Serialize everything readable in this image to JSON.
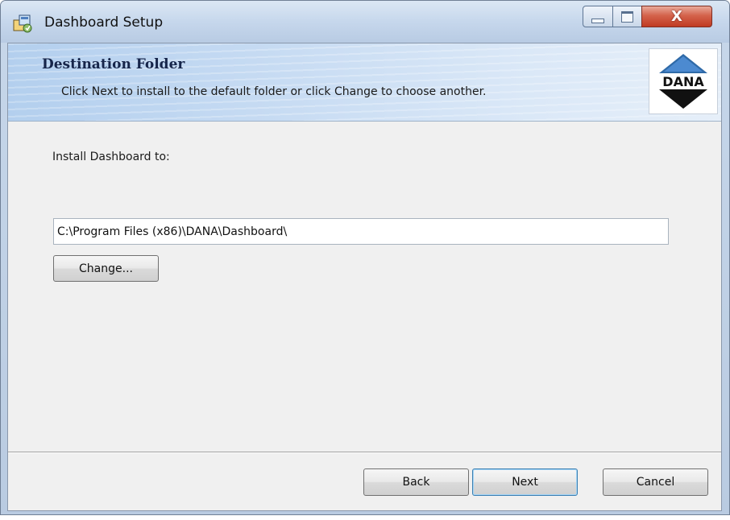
{
  "window": {
    "title": "Dashboard Setup",
    "icons": {
      "app": "setup-package-icon",
      "minimize": "minimize-icon",
      "maximize": "maximize-icon",
      "close": "close-icon"
    },
    "close_glyph": "X"
  },
  "banner": {
    "title": "Destination Folder",
    "description": "Click Next to install to the default folder or click Change to choose another.",
    "logo_text": "DANA"
  },
  "main": {
    "install_label": "Install Dashboard to:",
    "install_path": "C:\\Program Files (x86)\\DANA\\Dashboard\\",
    "change_button": "Change..."
  },
  "footer": {
    "back_button": "Back",
    "next_button": "Next",
    "cancel_button": "Cancel"
  },
  "colors": {
    "banner_title": "#16254a",
    "close_button": "#c03a22",
    "default_button_border": "#3c7fb1"
  }
}
